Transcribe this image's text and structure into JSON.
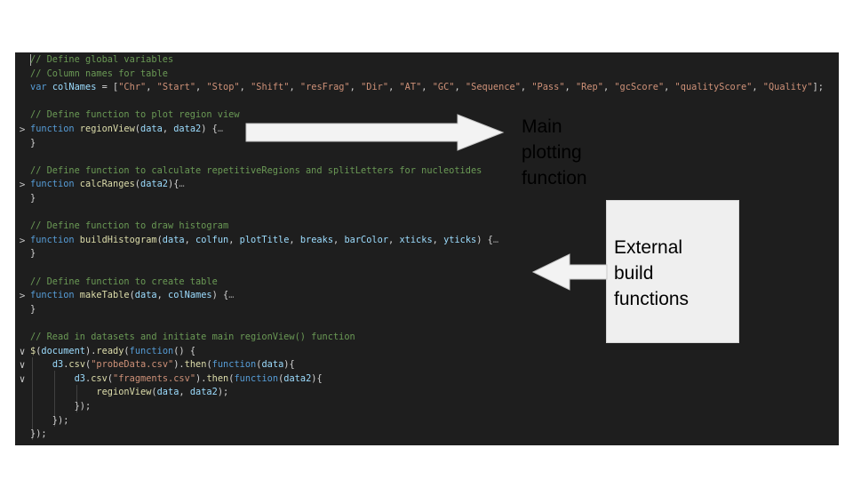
{
  "code_lines": [
    {
      "gutter": "",
      "fold_marker": false,
      "tokens": [
        [
          "cm",
          "// Define global variables"
        ]
      ]
    },
    {
      "gutter": "",
      "fold_marker": false,
      "tokens": [
        [
          "cm",
          "// Column names for table"
        ]
      ]
    },
    {
      "gutter": "",
      "fold_marker": false,
      "tokens": [
        [
          "kw",
          "var "
        ],
        [
          "var",
          "colNames"
        ],
        [
          "plain",
          " = ["
        ],
        [
          "str",
          "\"Chr\""
        ],
        [
          "plain",
          ", "
        ],
        [
          "str",
          "\"Start\""
        ],
        [
          "plain",
          ", "
        ],
        [
          "str",
          "\"Stop\""
        ],
        [
          "plain",
          ", "
        ],
        [
          "str",
          "\"Shift\""
        ],
        [
          "plain",
          ", "
        ],
        [
          "str",
          "\"resFrag\""
        ],
        [
          "plain",
          ", "
        ],
        [
          "str",
          "\"Dir\""
        ],
        [
          "plain",
          ", "
        ],
        [
          "str",
          "\"AT\""
        ],
        [
          "plain",
          ", "
        ],
        [
          "str",
          "\"GC\""
        ],
        [
          "plain",
          ", "
        ],
        [
          "str",
          "\"Sequence\""
        ],
        [
          "plain",
          ", "
        ],
        [
          "str",
          "\"Pass\""
        ],
        [
          "plain",
          ", "
        ],
        [
          "str",
          "\"Rep\""
        ],
        [
          "plain",
          ", "
        ],
        [
          "str",
          "\"gcScore\""
        ],
        [
          "plain",
          ", "
        ],
        [
          "str",
          "\"qualityScore\""
        ],
        [
          "plain",
          ", "
        ],
        [
          "str",
          "\"Quality\""
        ],
        [
          "plain",
          "];"
        ]
      ]
    },
    {
      "gutter": "",
      "fold_marker": false,
      "tokens": []
    },
    {
      "gutter": "",
      "fold_marker": false,
      "tokens": [
        [
          "cm",
          "// Define function to plot region view"
        ]
      ]
    },
    {
      "gutter": ">",
      "fold_marker": true,
      "tokens": [
        [
          "kw",
          "function "
        ],
        [
          "fn",
          "regionView"
        ],
        [
          "plain",
          "("
        ],
        [
          "var",
          "data"
        ],
        [
          "plain",
          ", "
        ],
        [
          "var",
          "data2"
        ],
        [
          "plain",
          ") {"
        ],
        [
          "fold",
          "…"
        ]
      ]
    },
    {
      "gutter": "",
      "fold_marker": false,
      "tokens": [
        [
          "plain",
          "}"
        ]
      ]
    },
    {
      "gutter": "",
      "fold_marker": false,
      "tokens": []
    },
    {
      "gutter": "",
      "fold_marker": false,
      "tokens": [
        [
          "cm",
          "// Define function to calculate repetitiveRegions and splitLetters for nucleotides"
        ]
      ]
    },
    {
      "gutter": ">",
      "fold_marker": true,
      "tokens": [
        [
          "kw",
          "function "
        ],
        [
          "fn",
          "calcRanges"
        ],
        [
          "plain",
          "("
        ],
        [
          "var",
          "data2"
        ],
        [
          "plain",
          "){"
        ],
        [
          "fold",
          "…"
        ]
      ]
    },
    {
      "gutter": "",
      "fold_marker": false,
      "tokens": [
        [
          "plain",
          "}"
        ]
      ]
    },
    {
      "gutter": "",
      "fold_marker": false,
      "tokens": []
    },
    {
      "gutter": "",
      "fold_marker": false,
      "tokens": [
        [
          "cm",
          "// Define function to draw histogram"
        ]
      ]
    },
    {
      "gutter": ">",
      "fold_marker": true,
      "tokens": [
        [
          "kw",
          "function "
        ],
        [
          "fn",
          "buildHistogram"
        ],
        [
          "plain",
          "("
        ],
        [
          "var",
          "data"
        ],
        [
          "plain",
          ", "
        ],
        [
          "var",
          "colfun"
        ],
        [
          "plain",
          ", "
        ],
        [
          "var",
          "plotTitle"
        ],
        [
          "plain",
          ", "
        ],
        [
          "var",
          "breaks"
        ],
        [
          "plain",
          ", "
        ],
        [
          "var",
          "barColor"
        ],
        [
          "plain",
          ", "
        ],
        [
          "var",
          "xticks"
        ],
        [
          "plain",
          ", "
        ],
        [
          "var",
          "yticks"
        ],
        [
          "plain",
          ") {"
        ],
        [
          "fold",
          "…"
        ]
      ]
    },
    {
      "gutter": "",
      "fold_marker": false,
      "tokens": [
        [
          "plain",
          "}"
        ]
      ]
    },
    {
      "gutter": "",
      "fold_marker": false,
      "tokens": []
    },
    {
      "gutter": "",
      "fold_marker": false,
      "tokens": [
        [
          "cm",
          "// Define function to create table"
        ]
      ]
    },
    {
      "gutter": ">",
      "fold_marker": true,
      "tokens": [
        [
          "kw",
          "function "
        ],
        [
          "fn",
          "makeTable"
        ],
        [
          "plain",
          "("
        ],
        [
          "var",
          "data"
        ],
        [
          "plain",
          ", "
        ],
        [
          "var",
          "colNames"
        ],
        [
          "plain",
          ") {"
        ],
        [
          "fold",
          "…"
        ]
      ]
    },
    {
      "gutter": "",
      "fold_marker": false,
      "tokens": [
        [
          "plain",
          "}"
        ]
      ]
    },
    {
      "gutter": "",
      "fold_marker": false,
      "tokens": []
    },
    {
      "gutter": "",
      "fold_marker": false,
      "tokens": [
        [
          "cm",
          "// Read in datasets and initiate main regionView() function"
        ]
      ]
    },
    {
      "gutter": "∨",
      "fold_marker": true,
      "tokens": [
        [
          "fn",
          "$"
        ],
        [
          "plain",
          "("
        ],
        [
          "var",
          "document"
        ],
        [
          "plain",
          ")."
        ],
        [
          "fn",
          "ready"
        ],
        [
          "plain",
          "("
        ],
        [
          "kw",
          "function"
        ],
        [
          "plain",
          "() {"
        ]
      ]
    },
    {
      "gutter": "∨",
      "fold_marker": true,
      "tokens": [
        [
          "plain",
          "    "
        ],
        [
          "var",
          "d3"
        ],
        [
          "plain",
          "."
        ],
        [
          "fn",
          "csv"
        ],
        [
          "plain",
          "("
        ],
        [
          "str",
          "\"probeData.csv\""
        ],
        [
          "plain",
          ")."
        ],
        [
          "fn",
          "then"
        ],
        [
          "plain",
          "("
        ],
        [
          "kw",
          "function"
        ],
        [
          "plain",
          "("
        ],
        [
          "var",
          "data"
        ],
        [
          "plain",
          "){"
        ]
      ]
    },
    {
      "gutter": "∨",
      "fold_marker": true,
      "tokens": [
        [
          "plain",
          "        "
        ],
        [
          "var",
          "d3"
        ],
        [
          "plain",
          "."
        ],
        [
          "fn",
          "csv"
        ],
        [
          "plain",
          "("
        ],
        [
          "str",
          "\"fragments.csv\""
        ],
        [
          "plain",
          ")."
        ],
        [
          "fn",
          "then"
        ],
        [
          "plain",
          "("
        ],
        [
          "kw",
          "function"
        ],
        [
          "plain",
          "("
        ],
        [
          "var",
          "data2"
        ],
        [
          "plain",
          "){"
        ]
      ]
    },
    {
      "gutter": "",
      "fold_marker": false,
      "tokens": [
        [
          "plain",
          "            "
        ],
        [
          "fn",
          "regionView"
        ],
        [
          "plain",
          "("
        ],
        [
          "var",
          "data"
        ],
        [
          "plain",
          ", "
        ],
        [
          "var",
          "data2"
        ],
        [
          "plain",
          ");"
        ]
      ]
    },
    {
      "gutter": "",
      "fold_marker": false,
      "tokens": [
        [
          "plain",
          "        });"
        ]
      ]
    },
    {
      "gutter": "",
      "fold_marker": false,
      "tokens": [
        [
          "plain",
          "    });"
        ]
      ]
    },
    {
      "gutter": "",
      "fold_marker": false,
      "tokens": [
        [
          "plain",
          "});"
        ]
      ]
    }
  ],
  "annotations": {
    "main_label": [
      "Main",
      "plotting",
      "function"
    ],
    "external_label": [
      "External",
      "build",
      "functions"
    ]
  },
  "colors": {
    "editor_bg": "#1e1e1e",
    "keyword": "#569cd6",
    "function": "#dcdcaa",
    "string": "#ce9178",
    "comment": "#6a9955",
    "variable": "#9cdcfe",
    "text": "#d4d4d4",
    "arrow_fill": "#f3f3f3",
    "arrow_stroke": "#c8c8c8",
    "label_box_bg": "#efefef"
  },
  "icons": {
    "fold_collapsed": "chevron-right-icon",
    "fold_expanded": "chevron-down-icon"
  }
}
